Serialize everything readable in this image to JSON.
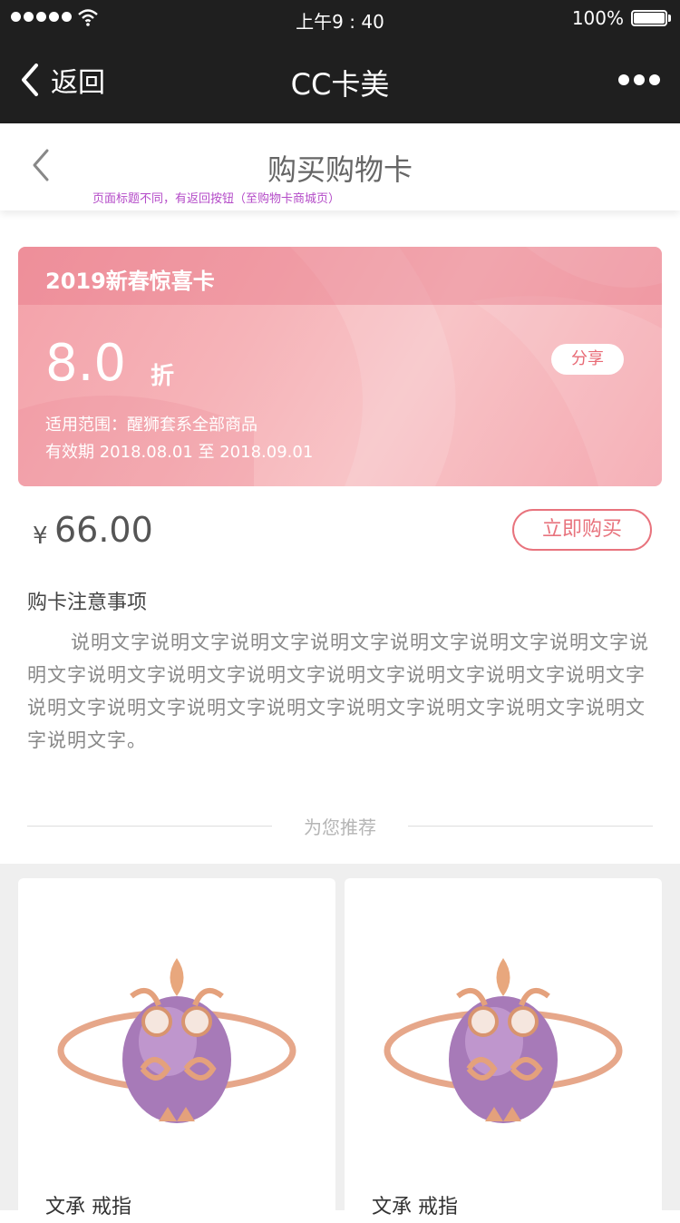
{
  "status_bar": {
    "time": "上午9 : 40",
    "battery": "100%"
  },
  "wechat_header": {
    "back_label": "返回",
    "title": "CC卡美"
  },
  "page_header": {
    "title": "购买购物卡",
    "note": "页面标题不同，有返回按钮（至购物卡商城页）"
  },
  "card": {
    "name": "2019新春惊喜卡",
    "discount": "8.0",
    "discount_unit": "折",
    "share_label": "分享",
    "scope": "适用范围：醒狮套系全部商品",
    "validity": "有效期 2018.08.01 至 2018.09.01"
  },
  "purchase": {
    "currency": "¥",
    "price": "66.00",
    "buy_label": "立即购买"
  },
  "notes": {
    "title": "购卡注意事项",
    "body": "说明文字说明文字说明文字说明文字说明文字说明文字说明文字说明文字说明文字说明文字说明文字说明文字说明文字说明文字说明文字说明文字说明文字说明文字说明文字说明文字说明文字说明文字说明文字说明文字。"
  },
  "recommend": {
    "label": "为您推荐",
    "products": [
      {
        "name": "文承  戒指"
      },
      {
        "name": "文承  戒指"
      }
    ]
  },
  "colors": {
    "header_bg": "#1f1f1f",
    "accent": "#e8737d",
    "card_pink": "#f4a8b0"
  }
}
